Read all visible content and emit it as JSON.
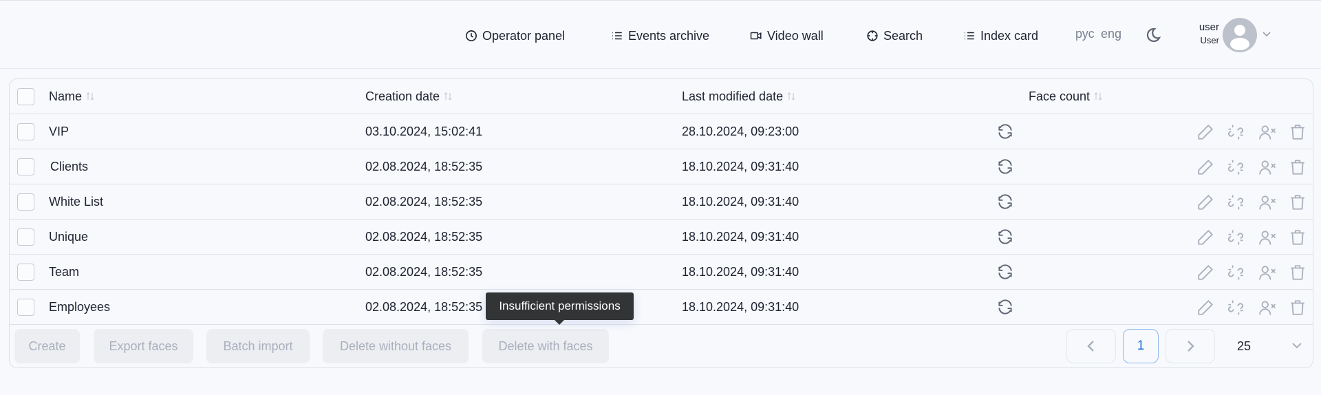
{
  "header": {
    "nav": [
      {
        "label": "Operator panel",
        "icon": "clock-icon"
      },
      {
        "label": "Events archive",
        "icon": "list-icon"
      },
      {
        "label": "Video wall",
        "icon": "video-camera-icon"
      },
      {
        "label": "Search",
        "icon": "crosshair-icon"
      },
      {
        "label": "Index card",
        "icon": "list-icon"
      }
    ],
    "languages": [
      "рус",
      "eng"
    ],
    "theme_icon": "moon-icon",
    "user": {
      "login": "user",
      "role": "User"
    }
  },
  "table": {
    "columns": [
      {
        "label": "Name",
        "sortable": true
      },
      {
        "label": "Creation date",
        "sortable": true
      },
      {
        "label": "Last modified date",
        "sortable": true
      },
      {
        "label": "Face count",
        "sortable": true
      }
    ],
    "rows": [
      {
        "name": "VIP",
        "created": "03.10.2024, 15:02:41",
        "modified": "28.10.2024, 09:23:00"
      },
      {
        "name": "Clients",
        "created": "02.08.2024, 18:52:35",
        "modified": "18.10.2024, 09:31:40"
      },
      {
        "name": "White List",
        "created": "02.08.2024, 18:52:35",
        "modified": "18.10.2024, 09:31:40"
      },
      {
        "name": "Unique",
        "created": "02.08.2024, 18:52:35",
        "modified": "18.10.2024, 09:31:40"
      },
      {
        "name": "Team",
        "created": "02.08.2024, 18:52:35",
        "modified": "18.10.2024, 09:31:40"
      },
      {
        "name": "Employees",
        "created": "02.08.2024, 18:52:35",
        "modified": "18.10.2024, 09:31:40"
      }
    ],
    "row_actions": [
      "refresh-icon",
      "edit-icon",
      "unlink-icon",
      "remove-user-icon",
      "trash-icon"
    ]
  },
  "footer": {
    "buttons": [
      "Create",
      "Export faces",
      "Batch import",
      "Delete without faces",
      "Delete with faces"
    ],
    "pagination": {
      "current_page": "1",
      "per_page": "25"
    }
  },
  "tooltip": {
    "text": "Insufficient permissions"
  },
  "colors": {
    "accent": "#1f6fe0",
    "disabled_text": "#a9b0bc",
    "tooltip_bg": "#333436"
  }
}
